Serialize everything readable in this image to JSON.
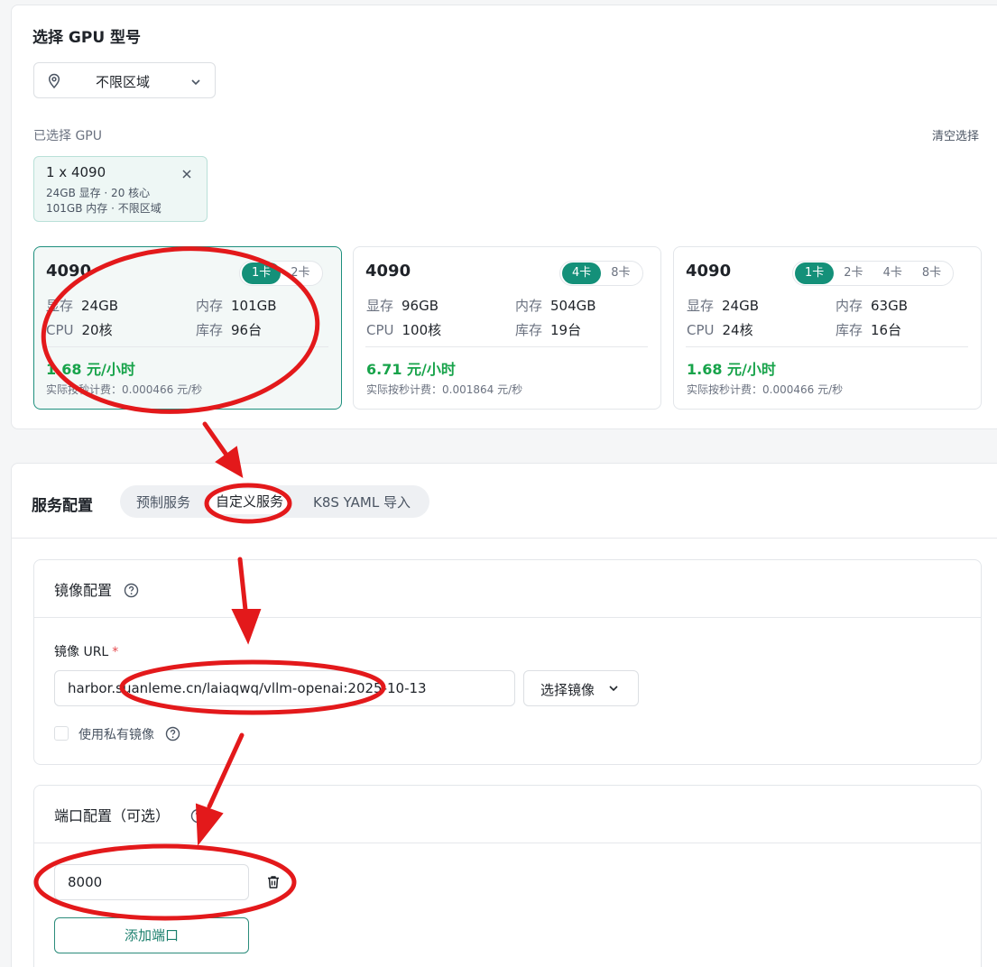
{
  "gpu_section": {
    "title": "选择 GPU 型号",
    "region_select": {
      "value": "不限区域"
    },
    "selected_label": "已选择 GPU",
    "clear_label": "清空选择",
    "selected_chip": {
      "title": "1 x 4090",
      "line1": "24GB 显存 · 20 核心",
      "line2": "101GB 内存 · 不限区域"
    },
    "cards": [
      {
        "name": "4090",
        "options": [
          "1卡",
          "2卡"
        ],
        "selected_option": "1卡",
        "vram_label": "显存",
        "vram": "24GB",
        "mem_label": "内存",
        "mem": "101GB",
        "cpu_label": "CPU",
        "cpu": "20核",
        "stock_label": "库存",
        "stock": "96台",
        "price": "1.68 元/小时",
        "per_second": "实际按秒计费：0.000466 元/秒"
      },
      {
        "name": "4090",
        "options": [
          "4卡",
          "8卡"
        ],
        "selected_option": "4卡",
        "vram_label": "显存",
        "vram": "96GB",
        "mem_label": "内存",
        "mem": "504GB",
        "cpu_label": "CPU",
        "cpu": "100核",
        "stock_label": "库存",
        "stock": "19台",
        "price": "6.71 元/小时",
        "per_second": "实际按秒计费：0.001864 元/秒"
      },
      {
        "name": "4090",
        "options": [
          "1卡",
          "2卡",
          "4卡",
          "8卡"
        ],
        "selected_option": "1卡",
        "vram_label": "显存",
        "vram": "24GB",
        "mem_label": "内存",
        "mem": "63GB",
        "cpu_label": "CPU",
        "cpu": "24核",
        "stock_label": "库存",
        "stock": "16台",
        "price": "1.68 元/小时",
        "per_second": "实际按秒计费：0.000466 元/秒"
      }
    ]
  },
  "service_section": {
    "title": "服务配置",
    "tabs": [
      "预制服务",
      "自定义服务",
      "K8S YAML 导入"
    ],
    "active_tab": "自定义服务",
    "image_box": {
      "title": "镜像配置",
      "url_label": "镜像 URL",
      "required_mark": "*",
      "url_value": "harbor.suanleme.cn/laiaqwq/vllm-openai:2025-10-13",
      "select_image_label": "选择镜像",
      "private_label": "使用私有镜像"
    },
    "port_box": {
      "title": "端口配置（可选）",
      "port_value": "8000",
      "add_port_label": "添加端口"
    }
  },
  "colors": {
    "accent": "#149079",
    "price_green": "#17a34a",
    "annotation_red": "#e3191b"
  },
  "icons": [
    "location-pin-icon",
    "chevron-down-icon",
    "close-icon",
    "help-circle-icon",
    "trash-icon"
  ]
}
